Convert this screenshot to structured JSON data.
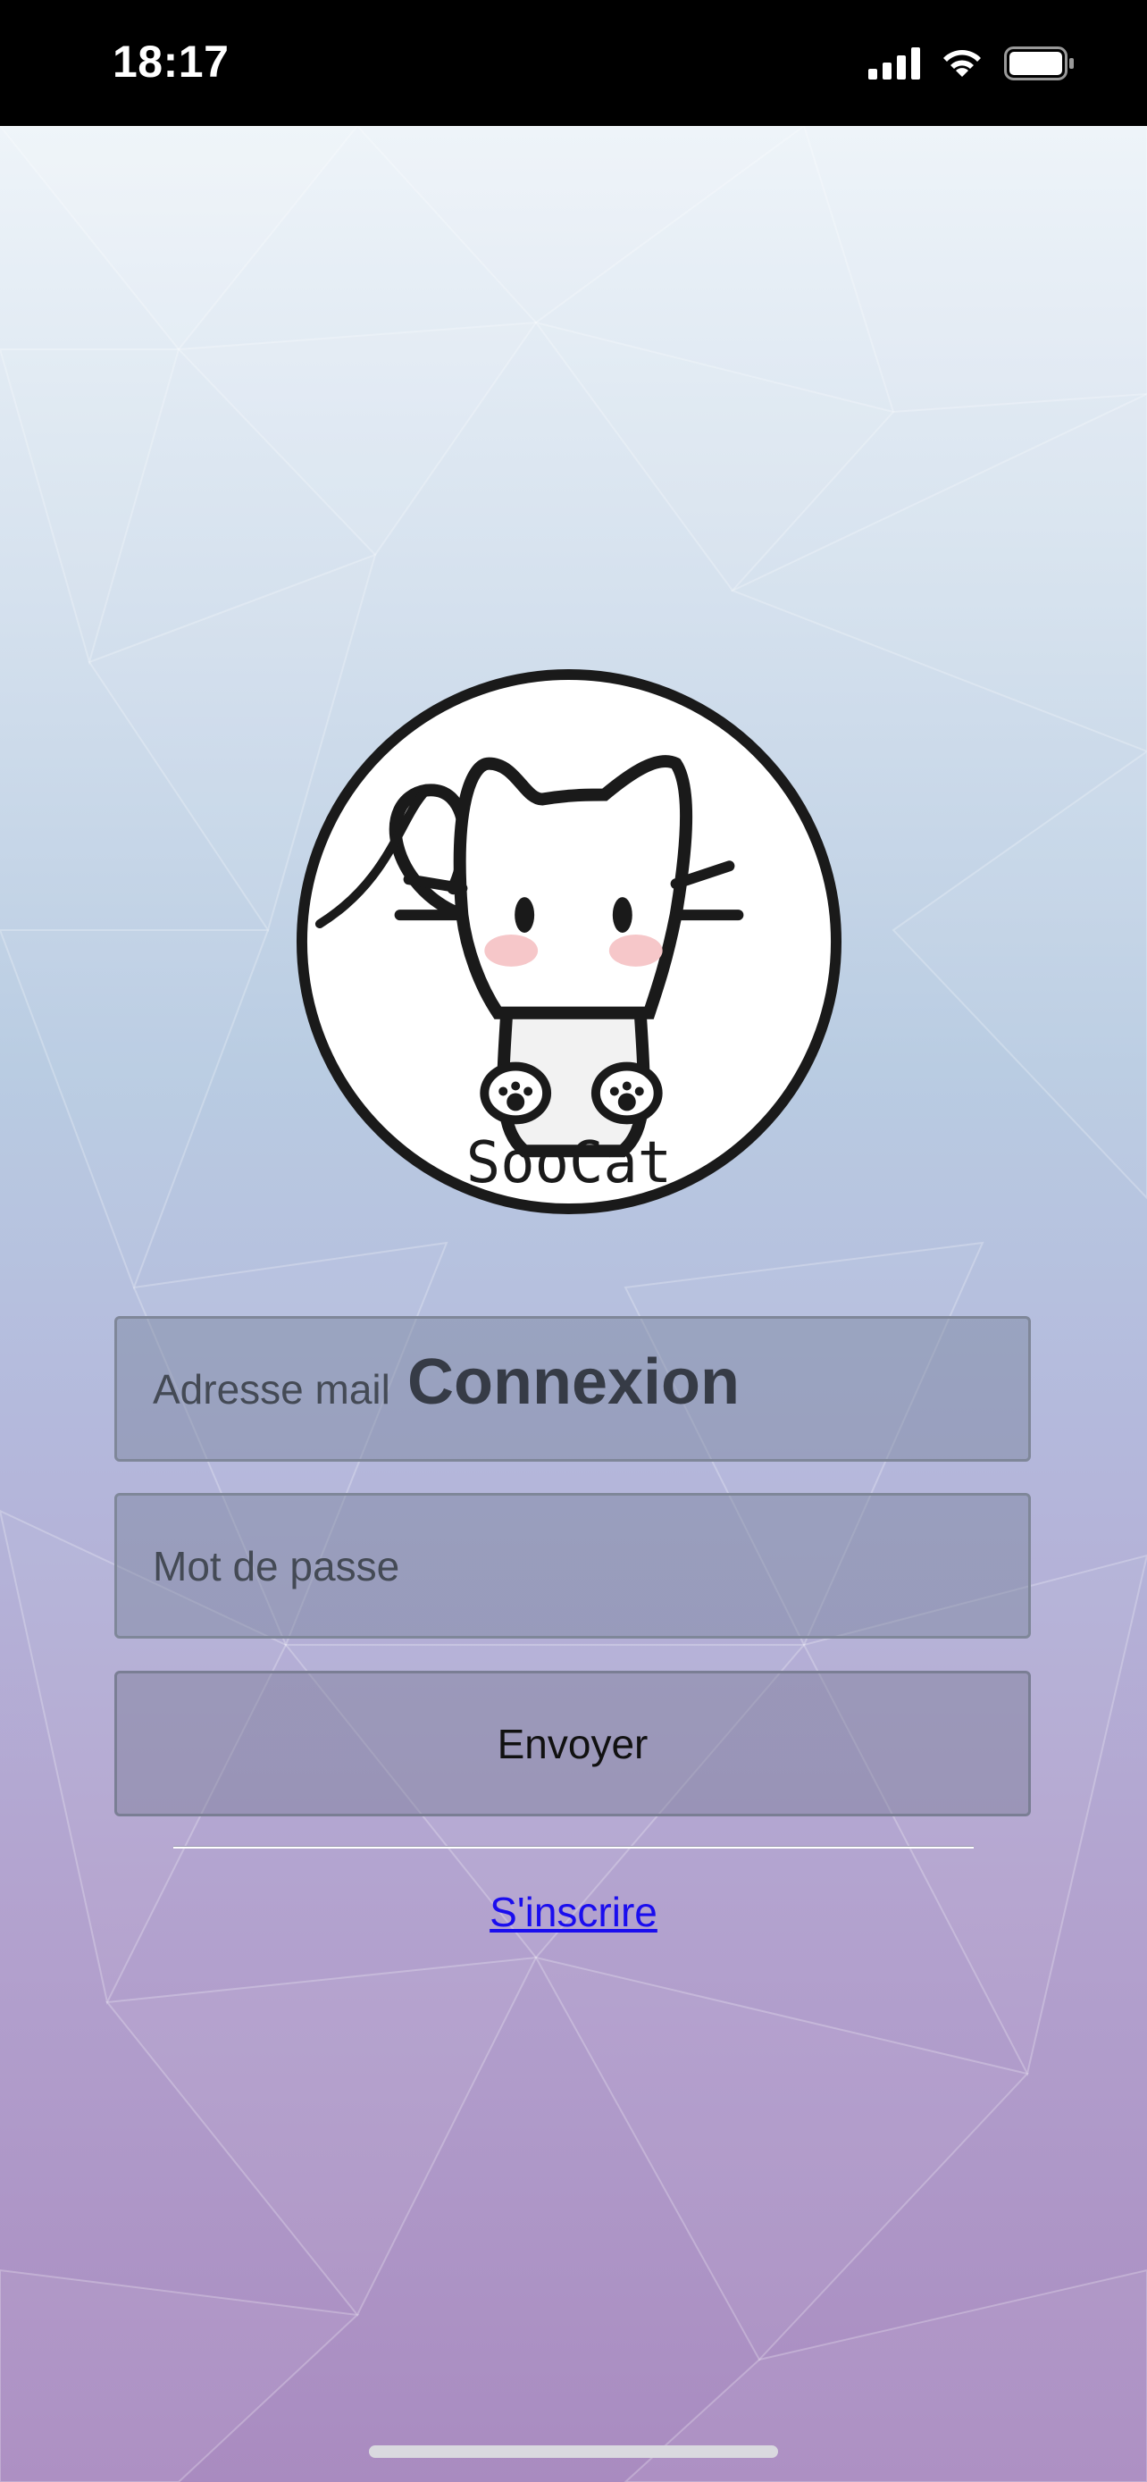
{
  "status_bar": {
    "time": "18:17",
    "icons": [
      "cellular-signal-icon",
      "wifi-icon",
      "battery-icon"
    ]
  },
  "logo": {
    "alt": "SooCat"
  },
  "login": {
    "title": "Connexion",
    "email_placeholder": "Adresse mail",
    "password_placeholder": "Mot de passe",
    "submit_label": "Envoyer",
    "signup_label": "S'inscrire"
  },
  "colors": {
    "link": "#1a0dee",
    "background_top": "#eef4f9",
    "background_bottom": "#a98bc0"
  }
}
